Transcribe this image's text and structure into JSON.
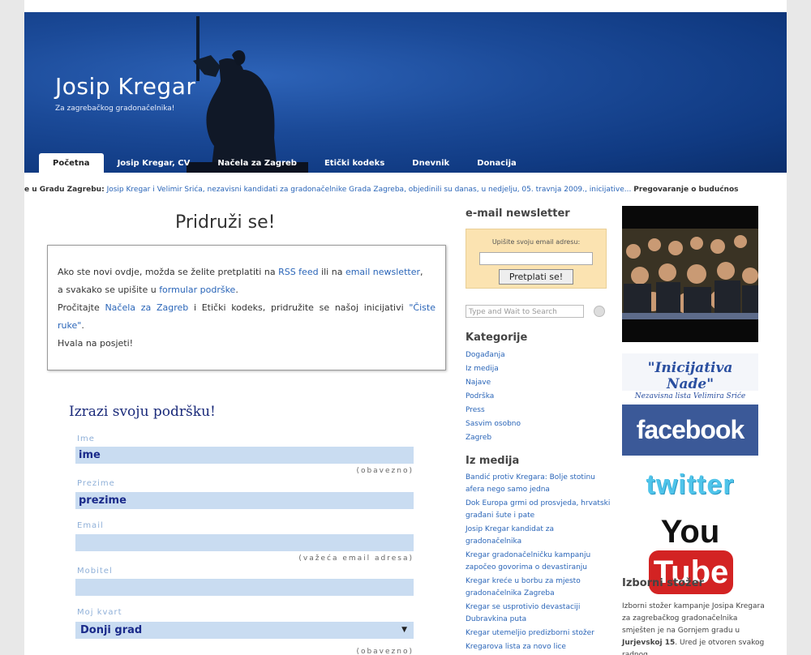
{
  "header": {
    "title": "Josip Kregar",
    "tagline": "Za zagrebačkog gradonačelnika!"
  },
  "nav": {
    "tabs": [
      {
        "label": "Početna",
        "active": true
      },
      {
        "label": "Josip Kregar, CV",
        "active": false
      },
      {
        "label": "Načela za Zagreb",
        "active": false
      },
      {
        "label": "Etički kodeks",
        "active": false
      },
      {
        "label": "Dnevnik",
        "active": false
      },
      {
        "label": "Donacija",
        "active": false
      }
    ]
  },
  "ticker": {
    "lead": "e u Gradu Zagrebu:",
    "text": "Josip Kregar i Velimir Srića, nezavisni kandidati za gradonačelnike Grada Zagreba, objedinili su danas, u nedjelju, 05. travnja 2009., inicijative...",
    "next": "Pregovaranje o budućnos"
  },
  "main": {
    "title": "Pridruži se!",
    "intro": {
      "p1_a": "Ako ste novi ovdje, možda se želite pretplatiti na ",
      "rss": "RSS feed",
      "p1_b": " ili na ",
      "newsletter": "email newsletter",
      "p1_c": ",",
      "p2_a": "a svakako se upišite u ",
      "formular": "formular podrške",
      "p2_b": ".",
      "p3_a": "Pročitajte ",
      "nacela": "Načela za Zagreb",
      "p3_b": " i Etički kodeks, pridružite se našoj inicijativi ",
      "ciste": "\"Čiste ruke\"",
      "p3_c": ".",
      "p4": "Hvala na posjeti!"
    },
    "form": {
      "title": "Izrazi svoju podršku!",
      "ime_label": "Ime",
      "ime_value": "ime",
      "ime_hint": "(obavezno)",
      "prezime_label": "Prezime",
      "prezime_value": "prezime",
      "email_label": "Email",
      "email_hint": "(važeća email adresa)",
      "mobitel_label": "Mobitel",
      "kvart_label": "Moj kvart",
      "kvart_value": "Donji grad",
      "kvart_hint": "(obavezno)"
    }
  },
  "sidebar": {
    "newsletter_title": "e-mail newsletter",
    "newsletter_label": "Upišite svoju email adresu:",
    "newsletter_button": "Pretplati se!",
    "search_placeholder": "Type and Wait to Search",
    "categories_title": "Kategorije",
    "categories": [
      "Događanja",
      "Iz medija",
      "Najave",
      "Podrška",
      "Press",
      "Sasvim osobno",
      "Zagreb"
    ],
    "media_title": "Iz medija",
    "media": [
      "Bandić protiv Kregara: Bolje stotinu afera nego samo jedna",
      "Dok Europa grmi od prosvjeda, hrvatski građani šute i pate",
      "Josip Kregar kandidat za gradonačelnika",
      "Kregar gradonačelničku kampanju započeo govorima o devastiranju",
      "Kregar kreće u borbu za mjesto gradonačelnika Zagreba",
      "Kregar se usprotivio devastaciji Dubravkina puta",
      "Kregar utemeljio predizborni stožer",
      "Kregarova lista za novo lice"
    ]
  },
  "right": {
    "nade_title": "\"Inicijativa Nade\"",
    "nade_sub": "Nezavisna lista Velimira Sriće",
    "facebook": "facebook",
    "twitter": "twitter",
    "youtube_you": "You",
    "youtube_tube": "Tube",
    "stozer_title": "Izborni stožer",
    "stozer_text_a": "Izborni stožer kampanje Josipa Kregara za zagrebačkog gradonačelnika smješten je na Gornjem gradu u ",
    "stozer_text_b": "Jurjevskoj 15",
    "stozer_text_c": ".",
    "stozer_text_d": "Ured je otvoren svakog radnog"
  }
}
